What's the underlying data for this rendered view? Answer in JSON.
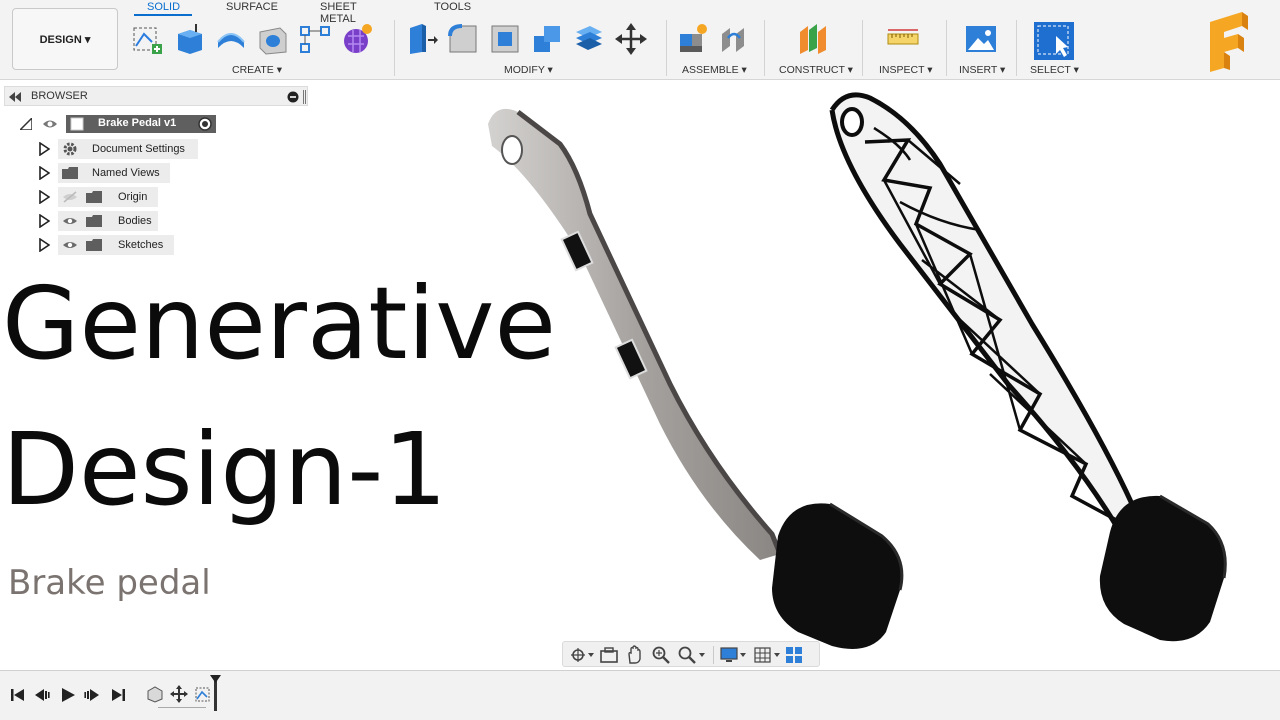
{
  "toolbar": {
    "workspace": "DESIGN ▾",
    "tabs": [
      "SOLID",
      "SURFACE",
      "SHEET METAL",
      "TOOLS"
    ],
    "groups": {
      "create": "CREATE ▾",
      "modify": "MODIFY ▾",
      "assemble": "ASSEMBLE ▾",
      "construct": "CONSTRUCT ▾",
      "inspect": "INSPECT ▾",
      "insert": "INSERT ▾",
      "select": "SELECT ▾"
    }
  },
  "browser": {
    "title": "BROWSER",
    "root": "Brake Pedal v1",
    "items": [
      "Document Settings",
      "Named Views",
      "Origin",
      "Bodies",
      "Sketches"
    ]
  },
  "overlay": {
    "line1": "Generative",
    "line2": "Design-1",
    "subtitle": "Brake pedal"
  },
  "colors": {
    "accent": "#0a6ecf",
    "toolbar_bg": "#f3f3f3",
    "title_text": "#0b0b0b",
    "subtitle_text": "#7a7370",
    "metal": "#a7a3a0",
    "pad": "#111111"
  }
}
